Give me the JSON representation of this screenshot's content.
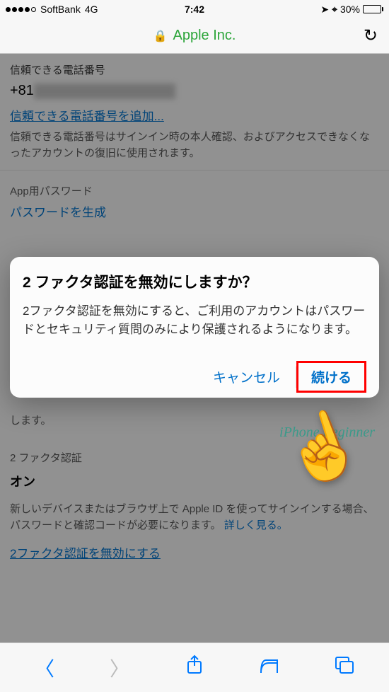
{
  "status": {
    "carrier": "SoftBank",
    "network": "4G",
    "time": "7:42",
    "battery_pct": "30%"
  },
  "url_bar": {
    "site": "Apple Inc."
  },
  "page": {
    "trusted_phone_heading": "信頼できる電話番号",
    "phone_prefix": "+81",
    "add_phone_link": "信頼できる電話番号を追加...",
    "phone_desc": "信頼できる電話番号はサインイン時の本人確認、およびアクセスできなくなったアカウントの復旧に使用されます。",
    "app_pwd_heading": "App用パスワード",
    "gen_pwd_link": "パスワードを生成",
    "truncated": "します。",
    "tfa_heading": "2 ファクタ認証",
    "tfa_status": "オン",
    "tfa_desc_1": "新しいデバイスまたはブラウザ上で Apple ID を使ってサインインする場合、パスワードと確認コードが必要になります。",
    "tfa_more": "詳しく見る。",
    "disable_tfa_link": "2ファクタ認証を無効にする"
  },
  "modal": {
    "title": "2 ファクタ認証を無効にしますか？",
    "body": "2ファクタ認証を無効にすると、ご利用のアカウントはパスワードとセキュリティ質問のみにより保護されるようになります。",
    "cancel": "キャンセル",
    "continue": "続ける"
  },
  "watermark": "iPhone Beginner"
}
